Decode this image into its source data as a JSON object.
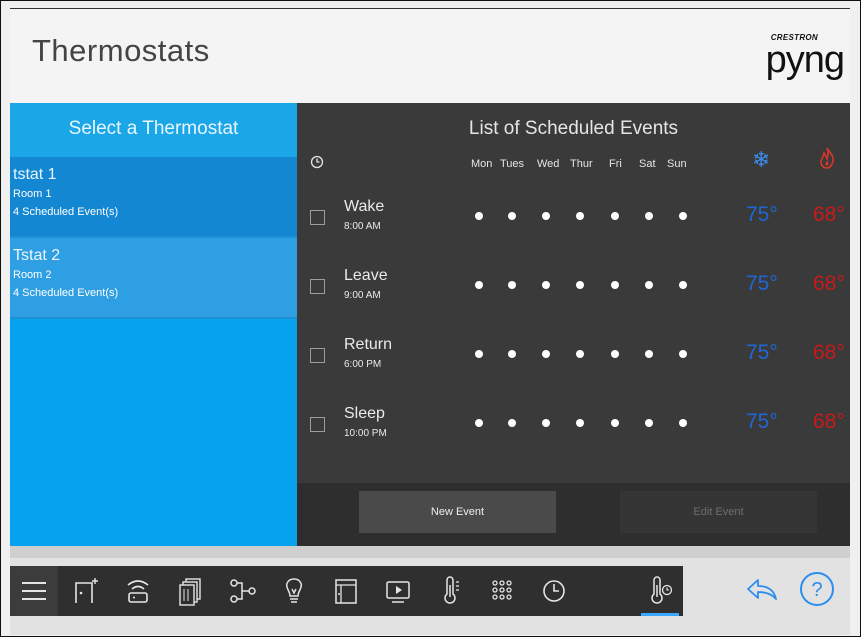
{
  "header": {
    "title": "Thermostats",
    "brand_small": "CRESTRON",
    "brand_big": "pyng"
  },
  "left": {
    "heading": "Select a Thermostat",
    "thermostats": [
      {
        "name": "tstat 1",
        "room": "Room 1",
        "events": "4 Scheduled Event(s)",
        "selected": true
      },
      {
        "name": "Tstat 2",
        "room": "Room 2",
        "events": "4 Scheduled Event(s)",
        "selected": false
      }
    ]
  },
  "schedule": {
    "title": "List of Scheduled Events",
    "days": [
      "Mon",
      "Tues",
      "Wed",
      "Thur",
      "Fri",
      "Sat",
      "Sun"
    ],
    "events": [
      {
        "name": "Wake",
        "time": "8:00 AM",
        "cool": "75°",
        "heat": "68°"
      },
      {
        "name": "Leave",
        "time": "9:00 AM",
        "cool": "75°",
        "heat": "68°"
      },
      {
        "name": "Return",
        "time": "6:00 PM",
        "cool": "75°",
        "heat": "68°"
      },
      {
        "name": "Sleep",
        "time": "10:00 PM",
        "cool": "75°",
        "heat": "68°"
      }
    ],
    "new_event": "New Event",
    "edit_event": "Edit Event"
  },
  "toolbar": {
    "icons": [
      "menu-icon",
      "room-add-icon",
      "wifi-router-icon",
      "shades-icon",
      "sequence-icon",
      "lightbulb-icon",
      "door-icon",
      "media-icon",
      "temperature-icon",
      "keypad-icon",
      "clock-icon",
      "thermostat-icon"
    ],
    "active": "thermostat-icon"
  },
  "colors": {
    "accent_blue": "#06a2ef",
    "cool": "#1f67d6",
    "heat": "#c81a1a",
    "panel": "#3a3a3a"
  }
}
